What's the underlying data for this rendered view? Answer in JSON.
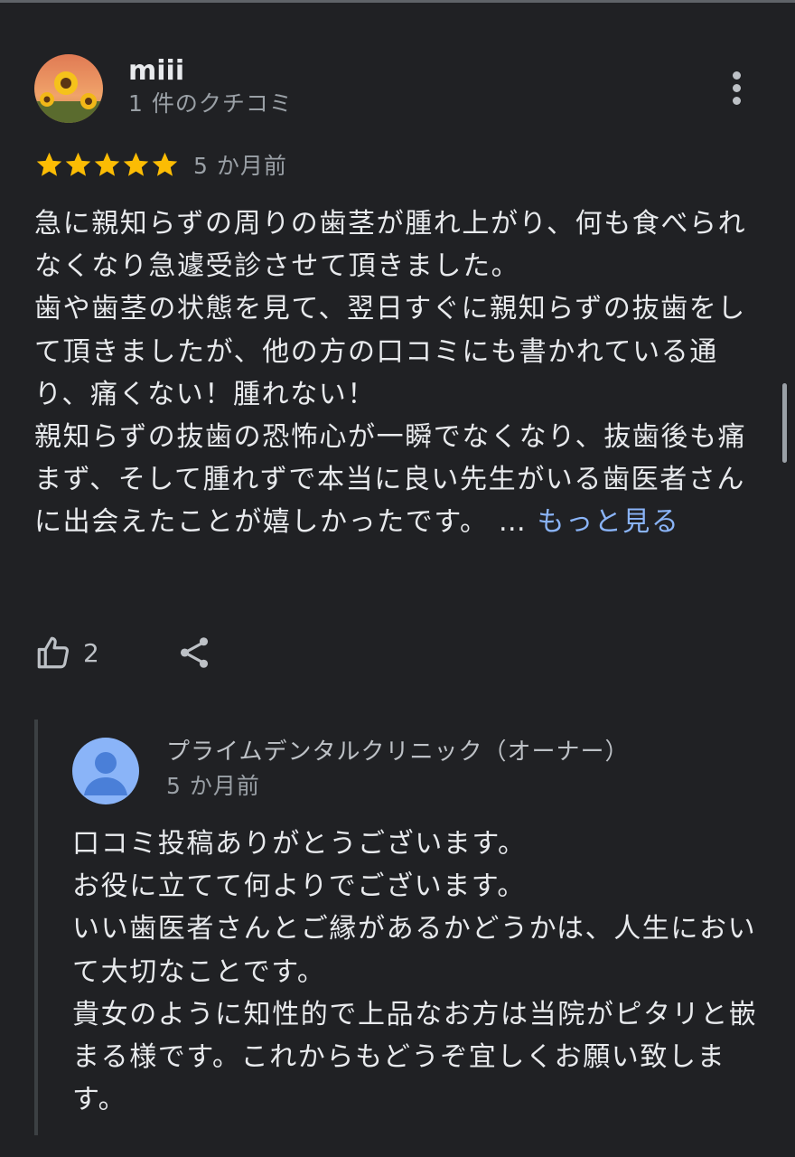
{
  "review": {
    "reviewer_name": "miii",
    "review_count": "1 件のクチコミ",
    "rating": 5,
    "time": "5 か月前",
    "paragraphs": [
      "急に親知らずの周りの歯茎が腫れ上がり、何も食べられなくなり急遽受診させて頂きました。",
      "歯や歯茎の状態を見て、翌日すぐに親知らずの抜歯をして頂きましたが、他の方の口コミにも書かれている通り、痛くない！腫れない！",
      "親知らずの抜歯の恐怖心が一瞬でなくなり、抜歯後も痛まず、そして腫れずで本当に良い先生がいる歯医者さんに出会えたことが嬉しかったです。"
    ],
    "ellipsis": " …",
    "more_link": "もっと見る",
    "like_count": "2"
  },
  "reply": {
    "owner_name": "プライムデンタルクリニック（オーナー）",
    "time": "5 か月前",
    "paragraphs": [
      "口コミ投稿ありがとうございます。",
      "お役に立てて何よりでございます。",
      "いい歯医者さんとご縁があるかどうかは、人生において大切なことです。",
      "貴女のように知性的で上品なお方は当院がピタリと嵌まる様です。これからもどうぞ宜しくお願い致します。"
    ]
  },
  "colors": {
    "background": "#202124",
    "star": "#fbbc04",
    "link": "#8ab4f8",
    "owner_avatar": "#8ab4f8"
  },
  "icons": {
    "more": "more-vert-icon",
    "like": "thumb-up-icon",
    "share": "share-icon",
    "star": "star-icon",
    "owner_avatar": "person-icon"
  }
}
